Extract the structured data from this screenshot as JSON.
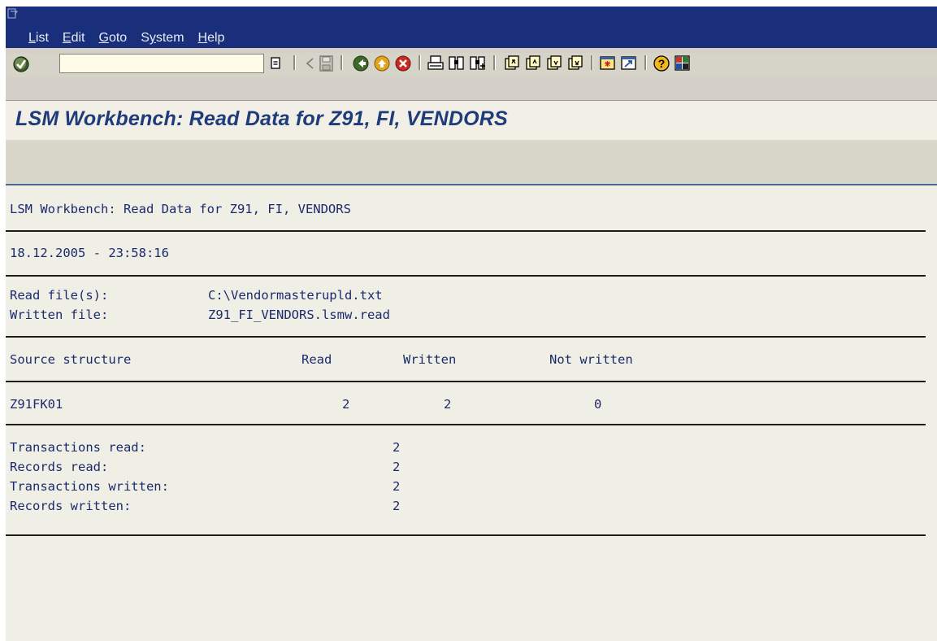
{
  "menubar": {
    "items": [
      {
        "label": "List",
        "mnemonic_index": 0
      },
      {
        "label": "Edit",
        "mnemonic_index": 0
      },
      {
        "label": "Goto",
        "mnemonic_index": 0
      },
      {
        "label": "System",
        "mnemonic_index": 1
      },
      {
        "label": "Help",
        "mnemonic_index": 0
      }
    ]
  },
  "toolbar": {
    "command_field_value": "",
    "icons": [
      "enter-icon",
      "history-icon",
      "back-arrow-icon",
      "save-icon",
      "back-icon",
      "exit-icon",
      "cancel-icon",
      "print-icon",
      "find-icon",
      "find-next-icon",
      "first-page-icon",
      "previous-page-icon",
      "next-page-icon",
      "last-page-icon",
      "create-session-icon",
      "shortcut-icon",
      "help-icon",
      "customize-layout-icon"
    ]
  },
  "title": "LSM Workbench: Read Data for Z91, FI, VENDORS",
  "report": {
    "header": "LSM Workbench: Read Data for Z91, FI, VENDORS",
    "timestamp": "18.12.2005 - 23:58:16",
    "files": [
      {
        "label": "Read file(s):",
        "value": "C:\\Vendormasterupld.txt"
      },
      {
        "label": "Written file:",
        "value": "Z91_FI_VENDORS.lsmw.read"
      }
    ],
    "table": {
      "headers": [
        "Source structure",
        "Read",
        "Written",
        "Not written"
      ],
      "rows": [
        [
          "Z91FK01",
          "2",
          "2",
          "0"
        ]
      ]
    },
    "summary": [
      {
        "label": "Transactions read:",
        "value": "2"
      },
      {
        "label": "Records read:",
        "value": "2"
      },
      {
        "label": "Transactions written:",
        "value": "2"
      },
      {
        "label": "Records written:",
        "value": "2"
      }
    ]
  }
}
